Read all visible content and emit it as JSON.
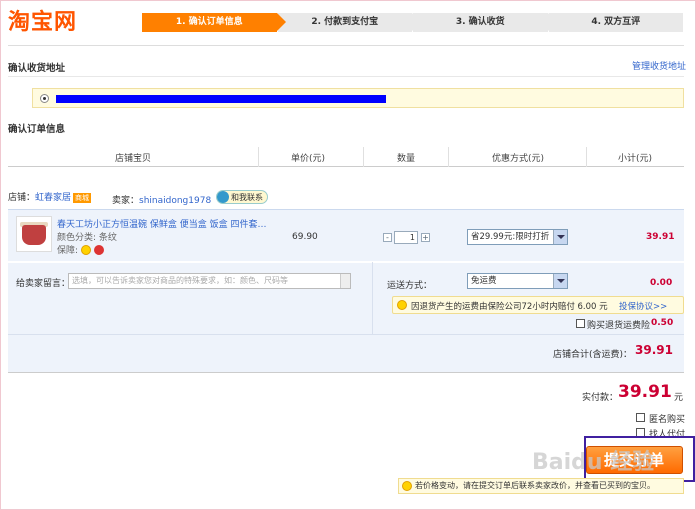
{
  "logo": "淘宝网",
  "steps": [
    "1. 确认订单信息",
    "2. 付款到支付宝",
    "3. 确认收货",
    "4. 双方互评"
  ],
  "address": {
    "title": "确认收货地址",
    "manage_link": "管理收货地址"
  },
  "order": {
    "title": "确认订单信息",
    "columns": {
      "item": "店铺宝贝",
      "price": "单价(元)",
      "qty": "数量",
      "discount": "优惠方式(元)",
      "subtotal": "小计(元)"
    }
  },
  "store": {
    "label": "店铺：",
    "name": "虹春家居",
    "badge": "商城",
    "seller_label": "卖家：",
    "seller": "shinaidong1978",
    "contact": "和我联系"
  },
  "item": {
    "title": "春天工坊小正方恒温碗 保鲜盒 便当盒 饭盒 四件套…",
    "sku": "颜色分类: 条纹",
    "guarantee_label": "保障:",
    "price": "69.90",
    "qty": "1",
    "qty_minus": "-",
    "qty_plus": "+",
    "discount_option": "省29.99元:限时打折",
    "subtotal": "39.91"
  },
  "message": {
    "label": "给卖家留言：",
    "placeholder": "选填，可以告诉卖家您对商品的特殊要求，如：颜色、尺码等"
  },
  "shipping": {
    "label": "运送方式：",
    "option": "免运费",
    "fee": "0.00",
    "insurance_text": "因退货产生的运费由保险公司72小时内赔付 6.00 元",
    "insurance_link": "投保协议>>",
    "insurance_check_label": "购买退货运费险",
    "insurance_price": "0.50"
  },
  "store_total": {
    "label": "店铺合计(含运费)：",
    "value": "39.91"
  },
  "payment": {
    "label": "实付款：",
    "value": "39.91",
    "unit": "元"
  },
  "options": {
    "anonymous": "匿名购买",
    "proxy_pay": "找人代付"
  },
  "submit_label": "提交订单",
  "watermark": "Baidu 经验",
  "tip": "若价格变动，请在提交订单后联系卖家改价，并查看已买到的宝贝。",
  "colors": {
    "accent": "#ff8000",
    "price": "#cc0033",
    "link": "#3366cc",
    "panel": "#eef3fb"
  }
}
